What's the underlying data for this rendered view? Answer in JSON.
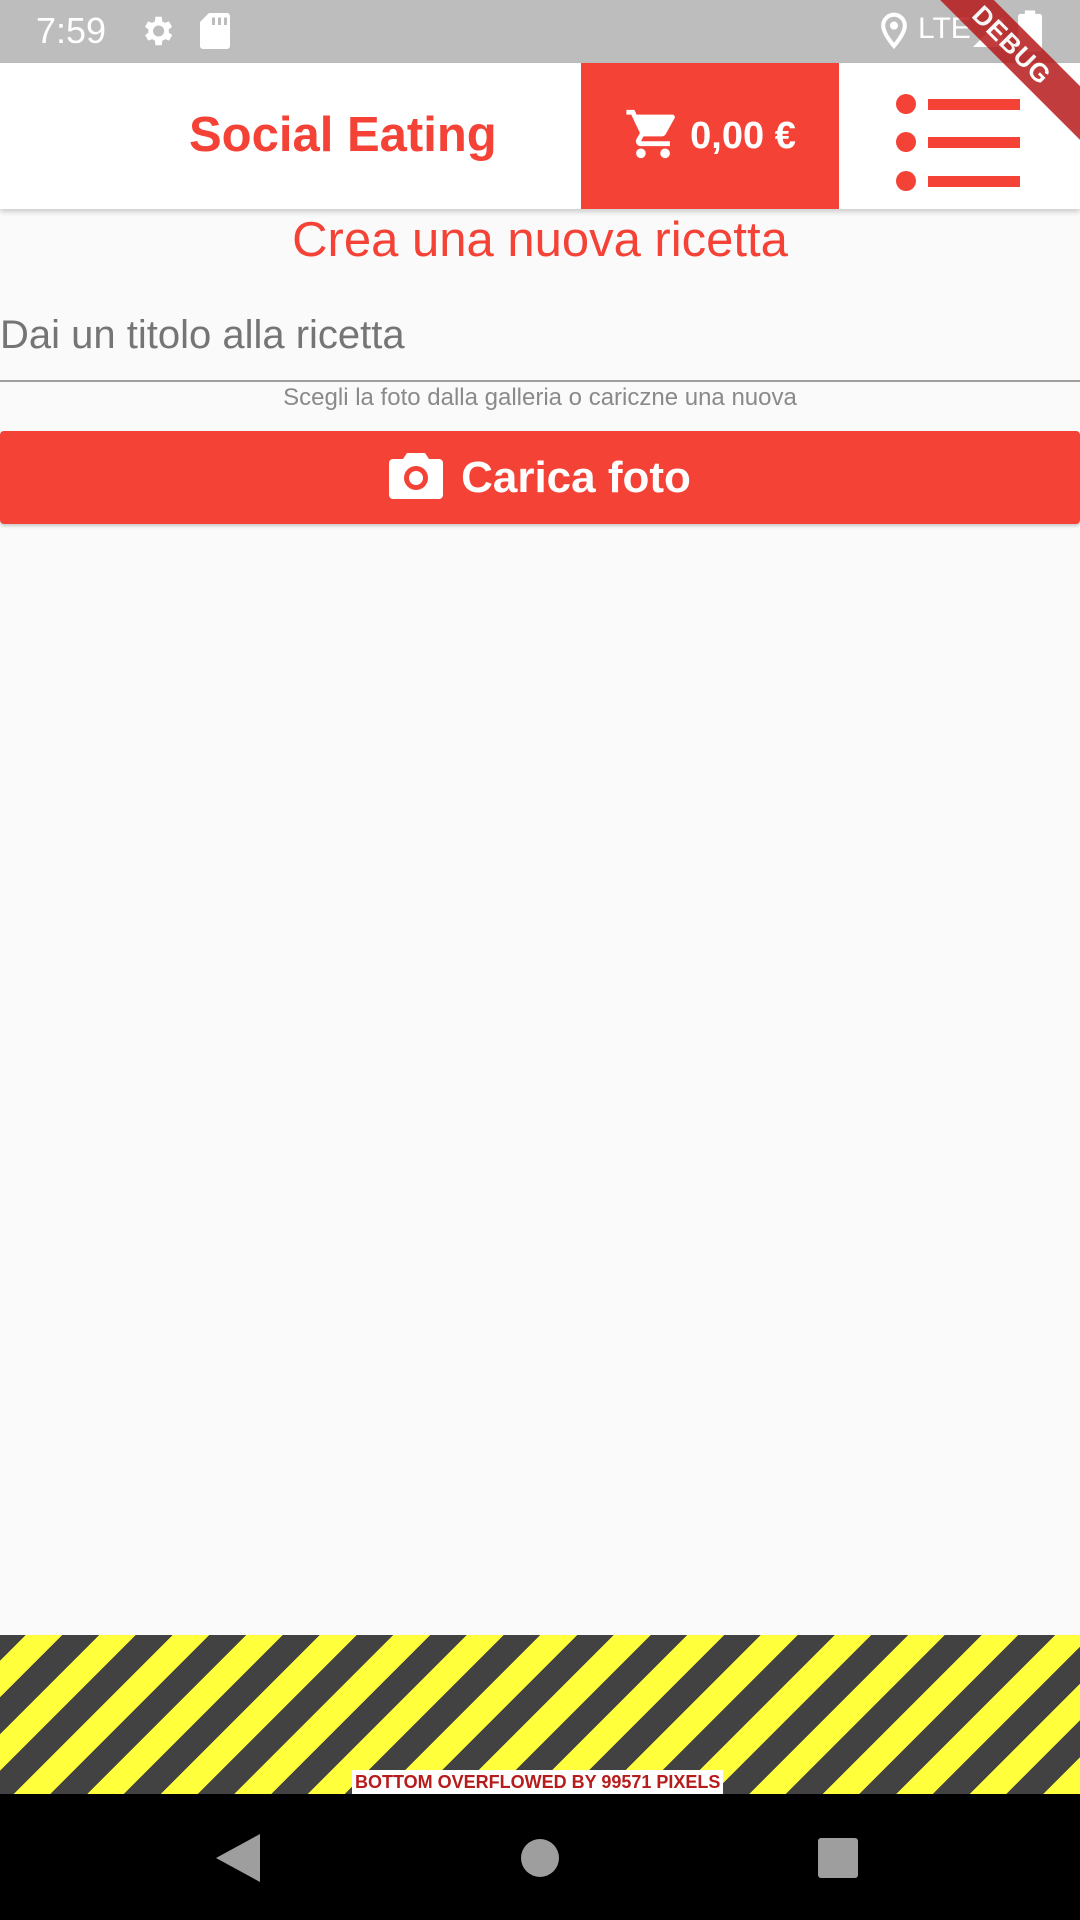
{
  "status_bar": {
    "time": "7:59",
    "network": "LTE",
    "icons": [
      "settings-icon",
      "sd-card-icon",
      "location-icon",
      "signal-icon",
      "battery-icon"
    ]
  },
  "debug_banner": "DEBUG",
  "app_bar": {
    "title": "Social Eating",
    "cart_amount": "0,00 €",
    "cart_icon": "shopping-cart-icon",
    "menu_icon": "list-menu-icon"
  },
  "main": {
    "heading": "Crea una nuova ricetta",
    "title_input_placeholder": "Dai un titolo alla ricetta",
    "title_input_value": "",
    "photo_hint": "Scegli la foto dalla galleria o cariczne una nuova",
    "upload_button_label": "Carica foto",
    "upload_icon": "camera-icon"
  },
  "overflow_warning": "BOTTOM OVERFLOWED BY 99571 PIXELS",
  "colors": {
    "accent": "#f44336",
    "status_bar": "#bdbdbd",
    "background": "#fafafa",
    "stripe_yellow": "#ffff3b",
    "stripe_dark": "#424242"
  },
  "nav_bar": {
    "icons": [
      "back-icon",
      "home-icon",
      "recents-icon"
    ]
  }
}
